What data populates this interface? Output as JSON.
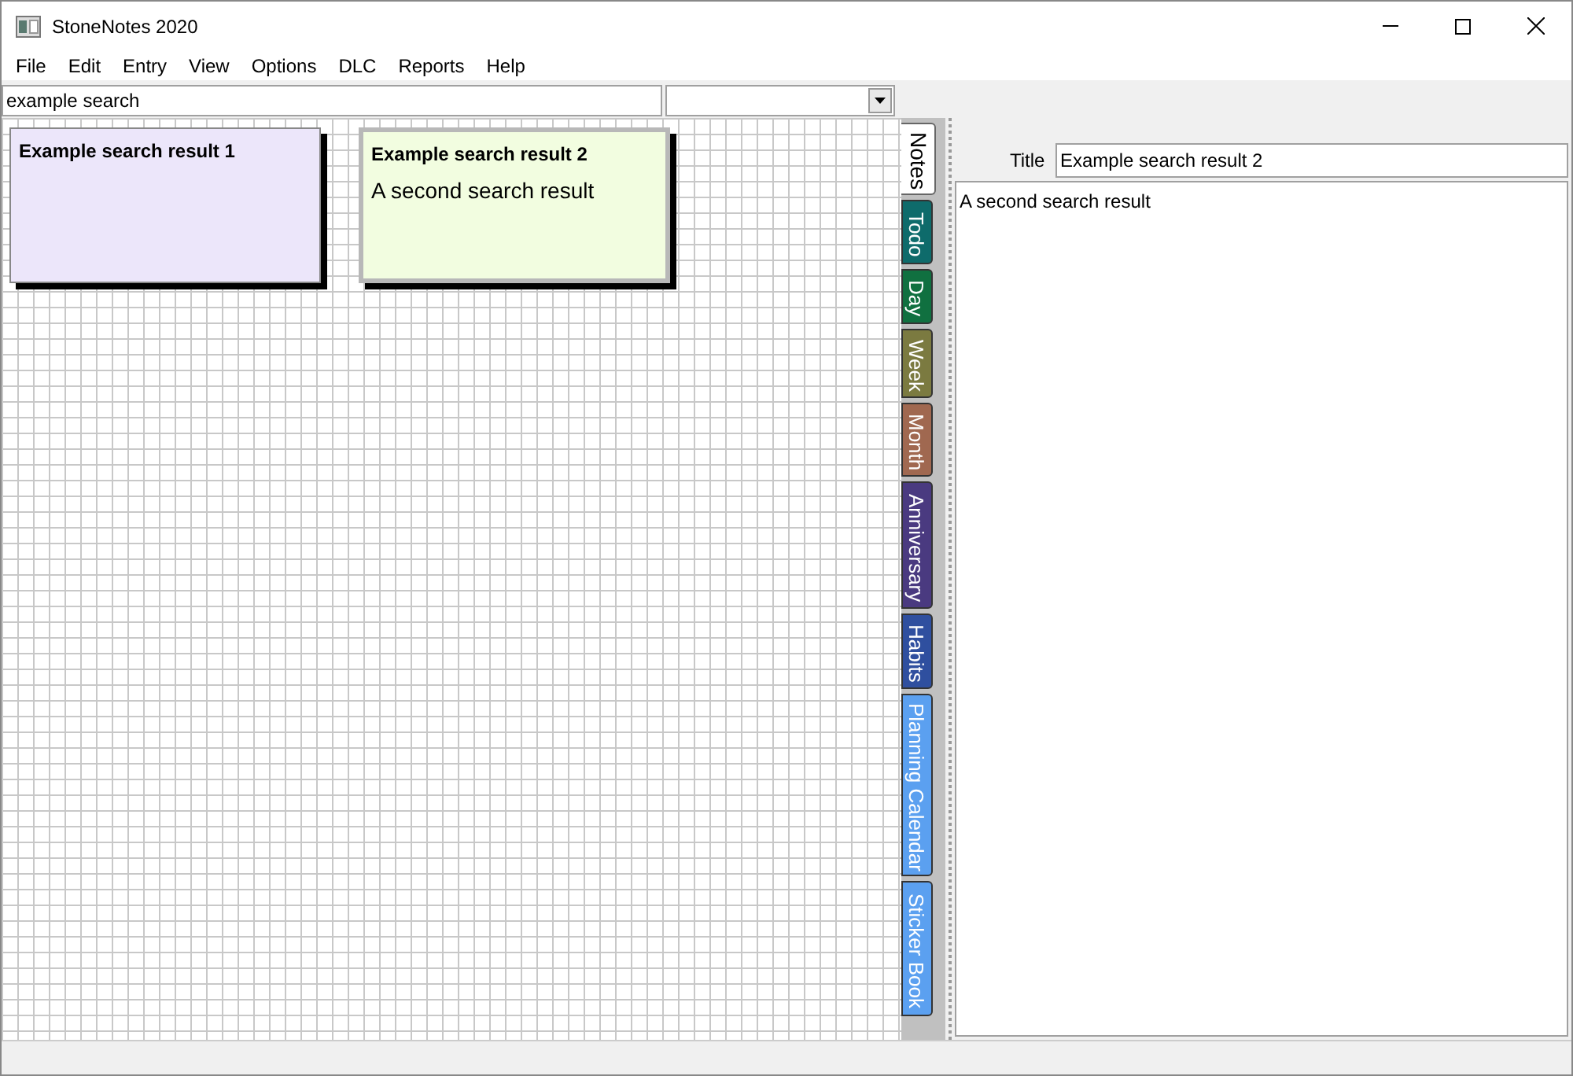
{
  "window": {
    "title": "StoneNotes 2020"
  },
  "menu": [
    "File",
    "Edit",
    "Entry",
    "View",
    "Options",
    "DLC",
    "Reports",
    "Help"
  ],
  "search": {
    "value": "example search"
  },
  "notes": [
    {
      "title": "Example search result 1",
      "color": "#ece6fa",
      "selected": false
    },
    {
      "title": "Example search result 2",
      "body": "A second search result",
      "color": "#f2fde0",
      "selected": true
    }
  ],
  "tabs": [
    {
      "label": "Notes",
      "selected": true,
      "color": "#ffffff"
    },
    {
      "label": "Todo",
      "selected": false,
      "color": "#0e6b6b"
    },
    {
      "label": "Day",
      "selected": false,
      "color": "#107040"
    },
    {
      "label": "Week",
      "selected": false,
      "color": "#7b7a40"
    },
    {
      "label": "Month",
      "selected": false,
      "color": "#a06850"
    },
    {
      "label": "Anniversary",
      "selected": false,
      "color": "#4a3a80"
    },
    {
      "label": "Habits",
      "selected": false,
      "color": "#2f4f9f"
    },
    {
      "label": "Planning Calendar",
      "selected": false,
      "color": "#5ba0f0"
    },
    {
      "label": "Sticker Book",
      "selected": false,
      "color": "#5ba0f0"
    }
  ],
  "editor": {
    "title_label": "Title",
    "title_value": "Example search result 2",
    "body": "A second search result"
  }
}
